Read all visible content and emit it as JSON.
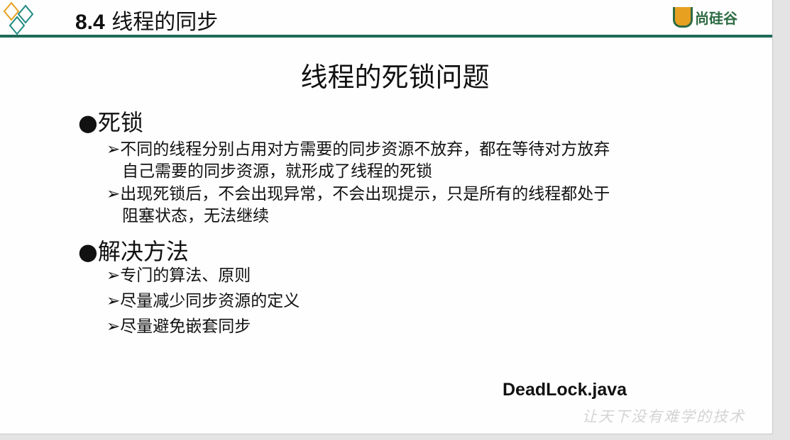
{
  "header": {
    "section": "8.4",
    "title": "线程的同步",
    "brand": "尚硅谷"
  },
  "slide": {
    "heading": "线程的死锁问题",
    "sections": [
      {
        "bullet": "死锁",
        "items": [
          {
            "line1": "不同的线程分别占用对方需要的同步资源不放弃，都在等待对方放弃",
            "line2": "自己需要的同步资源，就形成了线程的死锁"
          },
          {
            "line1": "出现死锁后，不会出现异常，不会出现提示，只是所有的线程都处于",
            "line2": "阻塞状态，无法继续"
          }
        ]
      },
      {
        "bullet": "解决方法",
        "items": [
          {
            "line1": "专门的算法、原则"
          },
          {
            "line1": "尽量减少同步资源的定义"
          },
          {
            "line1": "尽量避免嵌套同步"
          }
        ]
      }
    ],
    "file": "DeadLock.java",
    "watermark": "让天下没有难学的技术"
  },
  "colors": {
    "rule": "#1e6a57",
    "brand": "#2e6b44",
    "accent": "#e8a020"
  }
}
